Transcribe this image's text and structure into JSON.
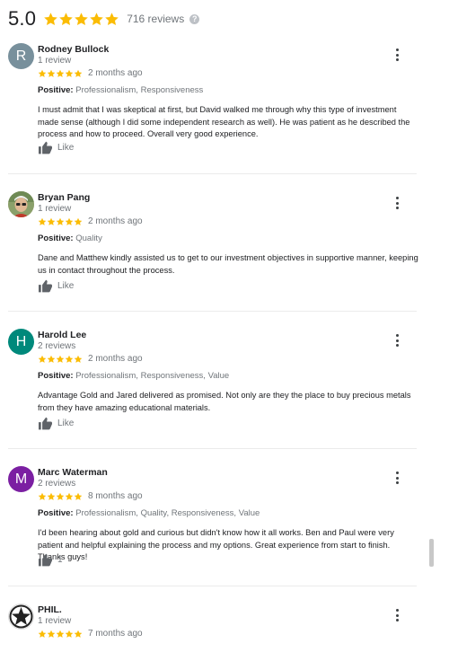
{
  "summary": {
    "score": "5.0",
    "stars": 5,
    "count_label": "716 reviews",
    "help_icon": "?"
  },
  "colors": {
    "star": "#fbbc04",
    "avatar_r": "#78909c",
    "avatar_h": "#00897b",
    "avatar_m": "#7b1fa2"
  },
  "reviews": [
    {
      "name": "Rodney Bullock",
      "count": "1 review",
      "initial": "R",
      "date": "2 months ago",
      "positive_label": "Positive:",
      "positive": "Professionalism, Responsiveness",
      "text": "I must admit that I was skeptical at first, but David walked me through why this type of investment made sense (although I did some independent research as well). He was patient as he described the process and how to proceed.  Overall very good experience.",
      "like": "Like"
    },
    {
      "name": "Bryan Pang",
      "count": "1 review",
      "initial": "",
      "date": "2 months ago",
      "positive_label": "Positive:",
      "positive": "Quality",
      "text": "Dane and Matthew kindly assisted us to get to our investment objectives in supportive manner, keeping us in contact throughout the process.",
      "like": "Like"
    },
    {
      "name": "Harold Lee",
      "count": "2 reviews",
      "initial": "H",
      "date": "2 months ago",
      "positive_label": "Positive:",
      "positive": "Professionalism, Responsiveness, Value",
      "text": "Advantage Gold and Jared delivered as promised. Not only are they the place to buy precious metals from they have amazing educational materials.",
      "like": "Like"
    },
    {
      "name": "Marc Waterman",
      "count": "2 reviews",
      "initial": "M",
      "date": "8 months ago",
      "positive_label": "Positive:",
      "positive": "Professionalism, Quality, Responsiveness, Value",
      "text": "I'd been hearing about gold and curious but didn't know how it all works.  Ben and Paul were very patient and helpful explaining the process and my options.  Great experience from start to finish.  Thanks guys!",
      "like": "1"
    },
    {
      "name": "PHIL.",
      "count": "1 review",
      "initial": "",
      "date": "7 months ago"
    }
  ]
}
